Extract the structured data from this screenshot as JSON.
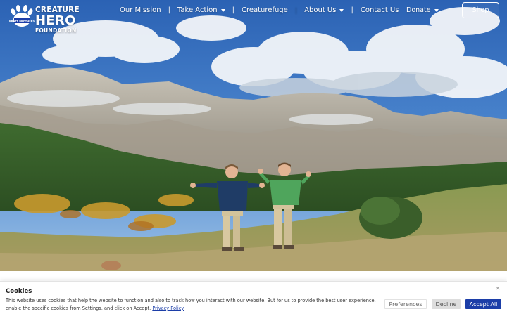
{
  "brand": {
    "badge_text": "KRATT BROTHERS",
    "line1": "CREATURE",
    "line2": "HERO",
    "line3": "FOUNDATION"
  },
  "nav": {
    "items": [
      {
        "label": "Our Mission",
        "has_dropdown": false
      },
      {
        "label": "Take Action",
        "has_dropdown": true
      },
      {
        "label": "Creaturefuge",
        "has_dropdown": false
      },
      {
        "label": "About Us",
        "has_dropdown": true
      },
      {
        "label": "Contact Us",
        "has_dropdown": false
      }
    ],
    "separator": "|",
    "donate_label": "Donate",
    "shop_label": "Shop"
  },
  "hero": {
    "image_subject": "two men cheering in a mountain meadow",
    "icon": "paw-icon"
  },
  "cookie": {
    "title": "Cookies",
    "text": "This website uses cookies that help the website to function and also to track how you interact with our website. But for us to provide the best user experience, enable the specific cookies from Settings, and click on Accept.",
    "link_label": "Privacy Policy",
    "close_label": "×",
    "preferences_label": "Preferences",
    "decline_label": "Decline",
    "accept_label": "Accept All"
  },
  "colors": {
    "accent": "#1c3ea8",
    "decline_bg": "#dddddd"
  }
}
